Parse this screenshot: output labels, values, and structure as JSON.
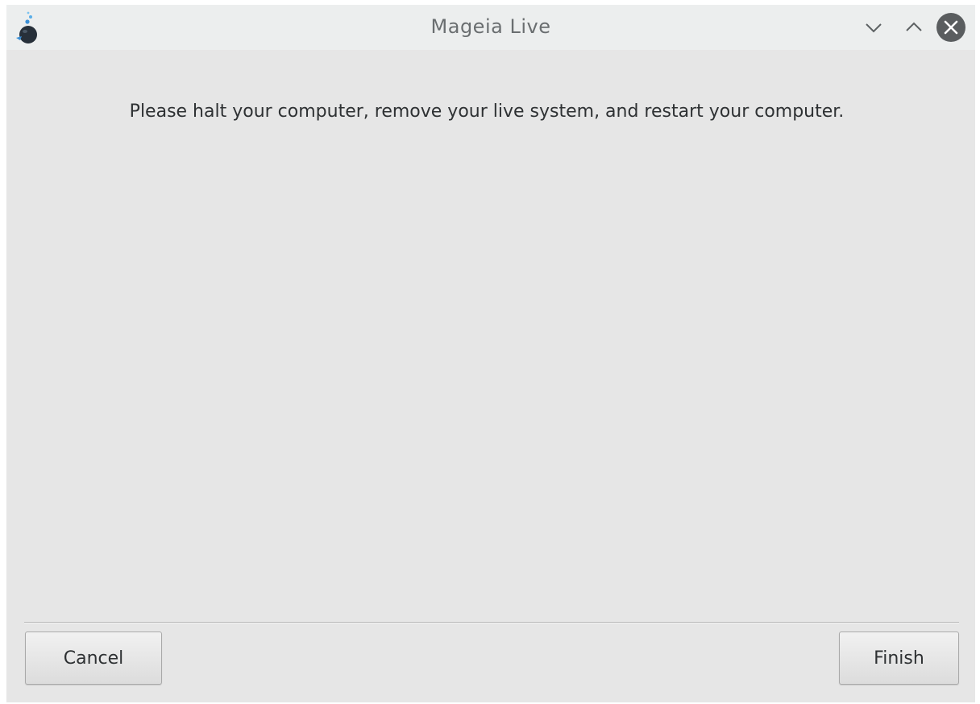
{
  "window": {
    "title": "Mageia Live",
    "controls": {
      "minimize_icon": "chevron-down-icon",
      "maximize_icon": "chevron-up-icon",
      "close_icon": "close-icon"
    }
  },
  "main": {
    "message": "Please halt your computer, remove your live system, and restart your computer."
  },
  "buttons": {
    "cancel_label": "Cancel",
    "finish_label": "Finish"
  },
  "colors": {
    "background": "#e6e6e6",
    "titlebar": "#eceeee",
    "close_button": "#5a5d5f",
    "text": "#2e3133"
  }
}
